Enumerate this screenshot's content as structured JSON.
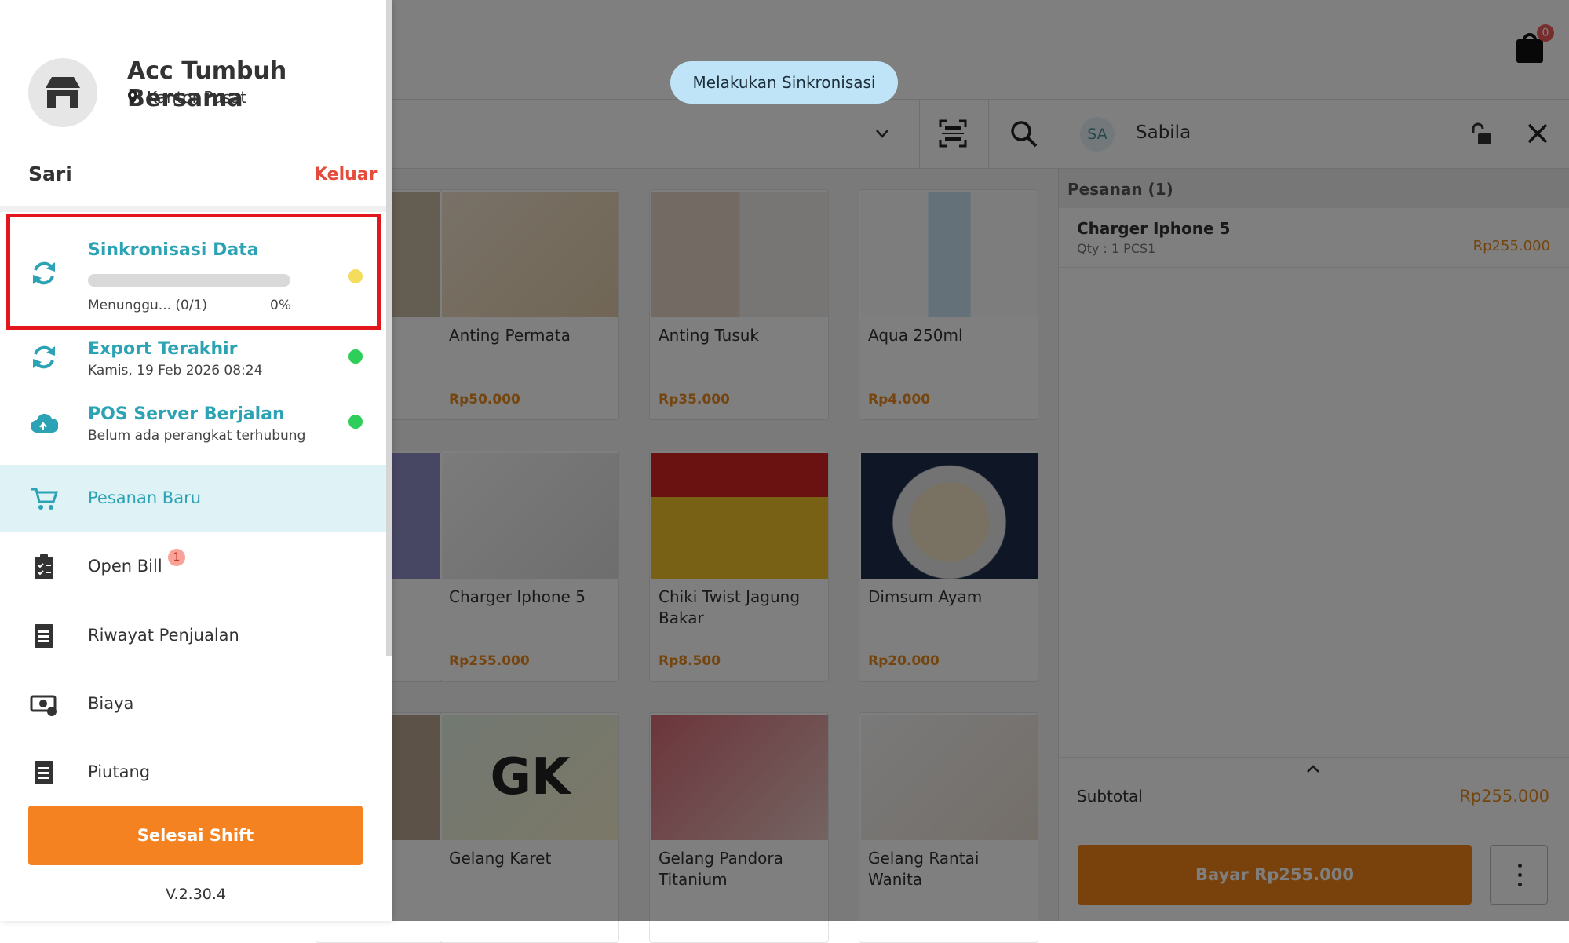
{
  "colors": {
    "accent": "#2ba3b5",
    "primary_button": "#f58220",
    "price": "#e98a1f",
    "danger": "#e54b3c",
    "sync_pending": "#f4dc5f",
    "status_ok": "#2fce5a",
    "highlight_box": "#e3161d"
  },
  "drawer": {
    "store_name": "Acc Tumbuh Bersama",
    "branch": "Kantor Pusat",
    "user": "Sari",
    "logout_label": "Keluar",
    "sync": {
      "title": "Sinkronisasi Data",
      "progress_text": "Menunggu... (0/1)",
      "progress_pct": "0%",
      "progress_value": 0.0
    },
    "status": [
      {
        "title": "Export Terakhir",
        "subtitle": "Kamis, 19 Feb 2026 08:24",
        "icon": "refresh-icon"
      },
      {
        "title": "POS Server Berjalan",
        "subtitle": "Belum ada perangkat terhubung",
        "icon": "cloud-icon"
      }
    ],
    "menu": [
      {
        "label": "Pesanan Baru",
        "icon": "cart-icon",
        "active": true
      },
      {
        "label": "Open Bill",
        "icon": "clipboard-icon",
        "badge": "1"
      },
      {
        "label": "Riwayat Penjualan",
        "icon": "document-icon"
      },
      {
        "label": "Biaya",
        "icon": "money-icon"
      },
      {
        "label": "Piutang",
        "icon": "document-icon"
      }
    ],
    "end_shift_label": "Selesai Shift",
    "version": "V.2.30.4"
  },
  "header": {
    "cart_count": "0",
    "sync_toast": "Melakukan Sinkronisasi"
  },
  "customer": {
    "initials": "SA",
    "name": "Sabila"
  },
  "products": [
    {
      "name": "Anting Permata",
      "price": "Rp50.000"
    },
    {
      "name": "Anting Tusuk",
      "price": "Rp35.000"
    },
    {
      "name": "Aqua 250ml",
      "price": "Rp4.000"
    },
    {
      "name": "Charger Iphone 5",
      "price": "Rp255.000"
    },
    {
      "name": "Chiki Twist Jagung Bakar",
      "price": "Rp8.500"
    },
    {
      "name": "Dimsum Ayam",
      "price": "Rp20.000"
    },
    {
      "name": "Gelang Karet",
      "price": "",
      "initials": "GK"
    },
    {
      "name": "Gelang Pandora Titanium",
      "price": ""
    },
    {
      "name": "Gelang Rantai Wanita",
      "price": ""
    }
  ],
  "order": {
    "header": "Pesanan (1)",
    "items": [
      {
        "name": "Charger Iphone 5",
        "qty": "Qty : 1 PCS1",
        "price": "Rp255.000"
      }
    ],
    "subtotal_label": "Subtotal",
    "subtotal": "Rp255.000",
    "pay_label": "Bayar Rp255.000"
  }
}
